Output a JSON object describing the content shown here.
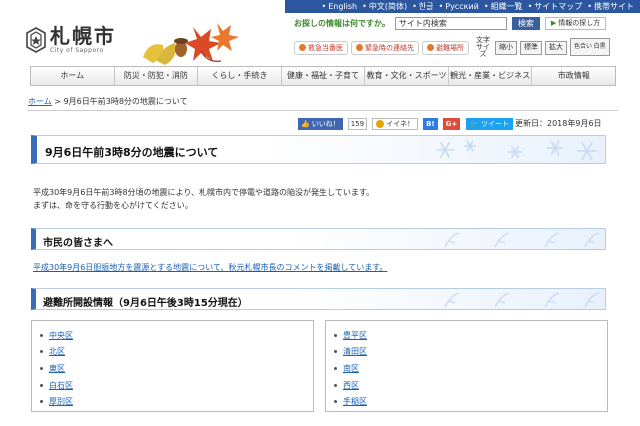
{
  "language_bar": [
    "English",
    "中文(简体)",
    "한글",
    "Русский",
    "組織一覧",
    "サイトマップ",
    "携帯サイト"
  ],
  "logo": {
    "name": "札幌市",
    "sub": "City of Sapporo"
  },
  "search": {
    "label": "お探しの情報は何ですか。",
    "value": "サイト内検索",
    "button": "検索",
    "help": "情報の探し方"
  },
  "quick_buttons": [
    "救急当番医",
    "緊急時の連絡先",
    "避難場所"
  ],
  "text_size": {
    "label": "文字サイズ",
    "shrink": "縮小",
    "standard": "標準",
    "enlarge": "拡大",
    "color": "色合い 白黒"
  },
  "nav": [
    "ホーム",
    "防災・防犯・消防",
    "くらし・手続き",
    "健康・福祉・子育て",
    "教育・文化・スポーツ",
    "観光・産業・ビジネス",
    "市政情報"
  ],
  "breadcrumb": {
    "home": "ホーム",
    "separator": " > ",
    "current": "9月6日午前3時8分の地震について"
  },
  "social": {
    "fb_like": "いいね！",
    "fb_count": "159",
    "iine": "イイネ！",
    "hatena": "B!",
    "gplus": "G+",
    "tweet": "ツイート"
  },
  "updated": "更新日：2018年9月6日",
  "title": "9月6日午前3時8分の地震について",
  "intro": [
    "平成30年9月6日午前3時8分頃の地震により、札幌市内で停電や道路の陥没が発生しています。",
    "まずは、命を守る行動を心がけてください。"
  ],
  "section_citizens": {
    "heading": "市民の皆さまへ",
    "link": "平成30年9月6日胆振地方を震源とする地震について、秋元札幌市長のコメントを掲載しています。"
  },
  "section_shelters": {
    "heading": "避難所開設情報（9月6日午後3時15分現在）",
    "left": [
      "中央区",
      "北区",
      "東区",
      "白石区",
      "厚別区"
    ],
    "right": [
      "豊平区",
      "清田区",
      "南区",
      "西区",
      "手稲区"
    ]
  },
  "colors": {
    "brand_blue": "#2c57a0",
    "link": "#1a5fb4",
    "accent_green": "#3a8c2a"
  }
}
